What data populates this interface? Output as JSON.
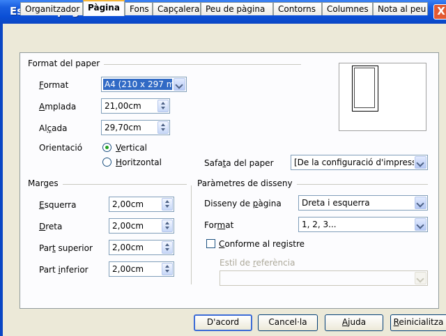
{
  "window": {
    "title": "Estil de pàgina: Per defecte",
    "close_glyph": "X"
  },
  "tabs": [
    {
      "label": "Organitzador"
    },
    {
      "label": "Pàgina",
      "active": true
    },
    {
      "label": "Fons"
    },
    {
      "label": "Capçalera"
    },
    {
      "label": "Peu de pàgina"
    },
    {
      "label": "Contorns"
    },
    {
      "label": "Columnes"
    },
    {
      "label": "Nota al peu"
    }
  ],
  "paper_format": {
    "section_label": "Format del paper",
    "format": {
      "label_accel": "F",
      "label_rest": "ormat",
      "value": "A4 (210 x 297 mm)"
    },
    "width": {
      "label_accel": "A",
      "label_rest": "mplada",
      "value": "21,00cm"
    },
    "height": {
      "label_pre": "Al",
      "label_accel": "ç",
      "label_rest": "ada",
      "value": "29,70cm"
    },
    "orientation": {
      "label": "Orientació",
      "portrait": {
        "label_accel": "V",
        "label_rest": "ertical",
        "selected": true
      },
      "landscape": {
        "label_accel": "H",
        "label_rest": "oritzontal",
        "selected": false
      }
    },
    "paper_tray": {
      "label_pre": "Safa",
      "label_accel": "t",
      "label_rest": "a del paper",
      "value": "[De la configuració d'impressora]"
    }
  },
  "margins": {
    "section_label": "Marges",
    "left": {
      "label_accel": "E",
      "label_rest": "squerra",
      "value": "2,00cm"
    },
    "right": {
      "label_accel": "D",
      "label_rest": "reta",
      "value": "2,00cm"
    },
    "top": {
      "label_pre": "Par",
      "label_accel": "t",
      "label_rest": " superior",
      "value": "2,00cm"
    },
    "bottom": {
      "label_pre": "Part ",
      "label_accel": "i",
      "label_rest": "nferior",
      "value": "2,00cm"
    }
  },
  "layout": {
    "section_label": "Paràmetres de disseny",
    "page_layout": {
      "label_pre": "Disseny de ",
      "label_accel": "p",
      "label_rest": "àgina",
      "value": "Dreta i esquerra"
    },
    "format": {
      "label_pre": "For",
      "label_accel": "m",
      "label_rest": "at",
      "value": "1, 2, 3..."
    },
    "register_true": {
      "label_accel": "C",
      "label_rest": "onforme al registre",
      "checked": false
    },
    "reference_style": {
      "label_pre": "Estil de ",
      "label_accel": "r",
      "label_rest": "eferència",
      "value": "",
      "disabled": true
    }
  },
  "buttons": {
    "ok": "D'acord",
    "cancel": "Cancel·la",
    "help_accel": "A",
    "help_rest": "juda",
    "reset_accel": "R",
    "reset_rest": "einicialitza"
  }
}
